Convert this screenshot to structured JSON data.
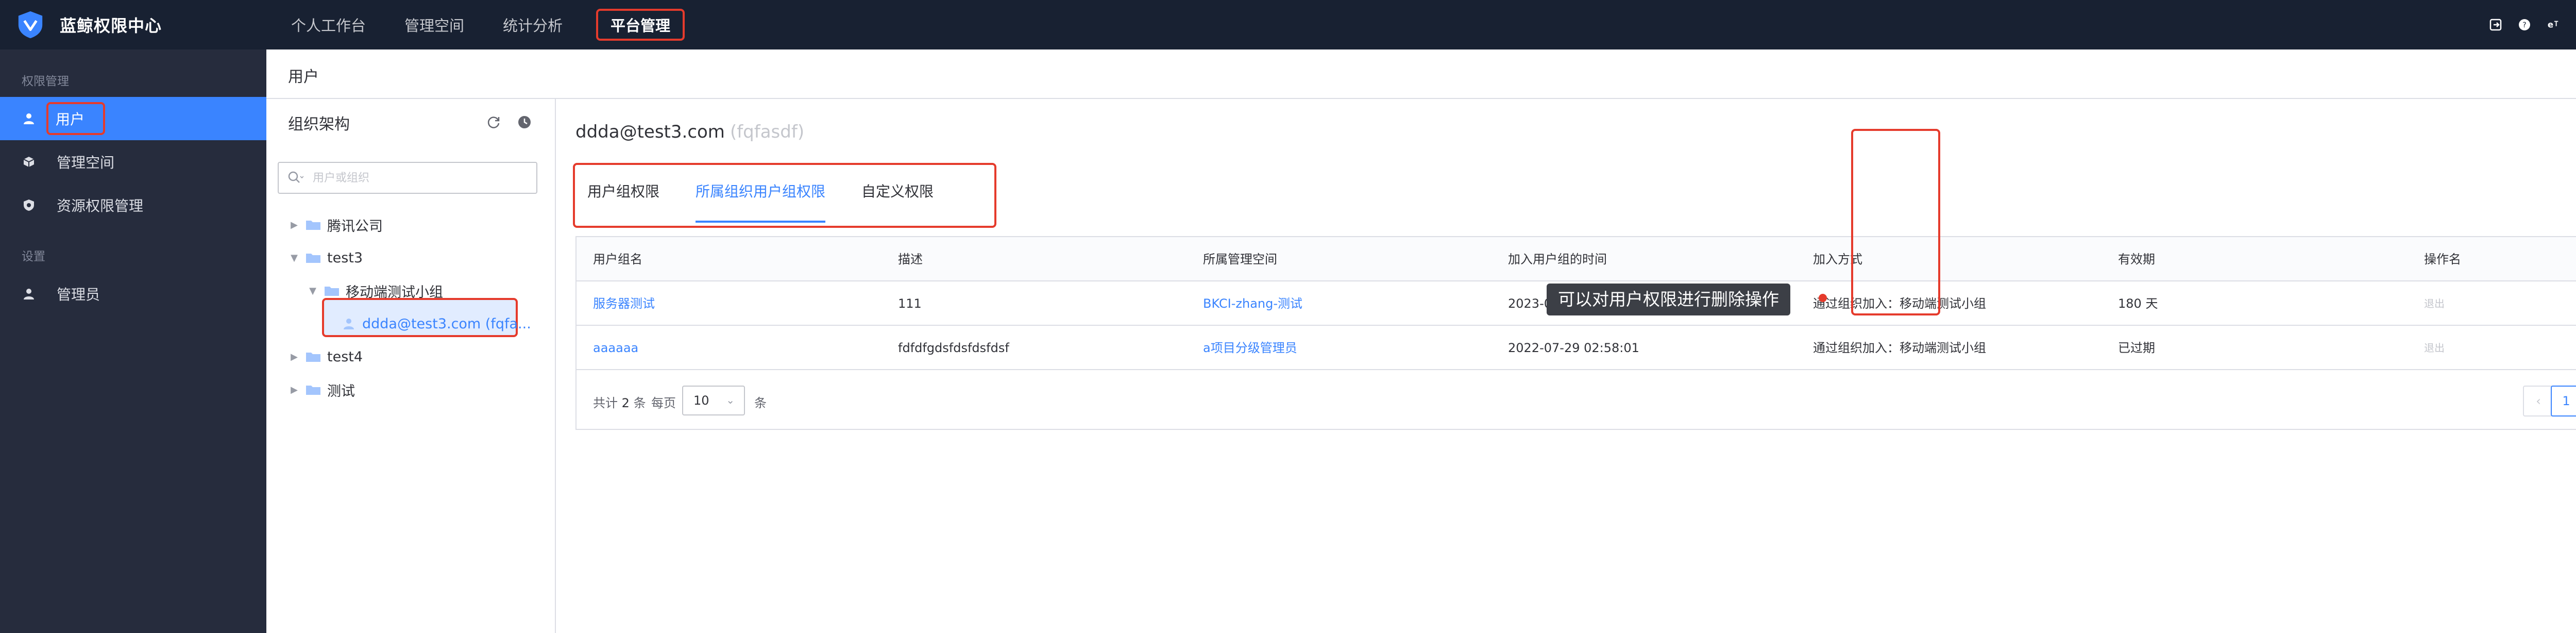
{
  "topbar": {
    "brand": "蓝鲸权限中心",
    "nav": [
      "个人工作台",
      "管理空间",
      "统计分析",
      "平台管理"
    ],
    "active_nav": "平台管理",
    "user": "u"
  },
  "sidebar": {
    "groups": [
      {
        "title": "权限管理",
        "items": [
          "用户",
          "管理空间",
          "资源权限管理"
        ]
      },
      {
        "title": "设置",
        "items": [
          "管理员"
        ]
      }
    ]
  },
  "breadcrumb": "用户",
  "org": {
    "title": "组织架构",
    "search_placeholder": "用户或组织",
    "tree": {
      "n0": "腾讯公司",
      "n1": "test3",
      "n1_child": "移动端测试小组",
      "n1_child_user": "ddda@test3.com (fqfa...",
      "n2": "test4",
      "n3": "测试"
    }
  },
  "main": {
    "user_email": "ddda@test3.com",
    "user_id": "(fqfasdf)",
    "tabs": [
      "用户组权限",
      "所属组织用户组权限",
      "自定义权限"
    ],
    "active_tab": "所属组织用户组权限",
    "table": {
      "headers": [
        "用户组名",
        "描述",
        "所属管理空间",
        "加入用户组的时间",
        "加入方式",
        "有效期",
        "操作名"
      ],
      "rows": [
        [
          "服务器测试",
          "111",
          "BKCI-zhang-测试",
          "2023-07-18 12:05:22",
          "通过组织加入：移动端测试小组",
          "180 天",
          "退出"
        ],
        [
          "aaaaaa",
          "fdfdfgdsfdsfdsfdsf",
          "a项目分级管理员",
          "2022-07-29 02:58:01",
          "通过组织加入：移动端测试小组",
          "已过期",
          "退出"
        ]
      ]
    },
    "pager": {
      "total_prefix": "共计",
      "total": "2",
      "total_suffix": "条",
      "per_page_label": "每页",
      "page_size": "10",
      "unit": "条",
      "current_page": "1"
    },
    "tooltip": "可以对用户权限进行删除操作"
  }
}
